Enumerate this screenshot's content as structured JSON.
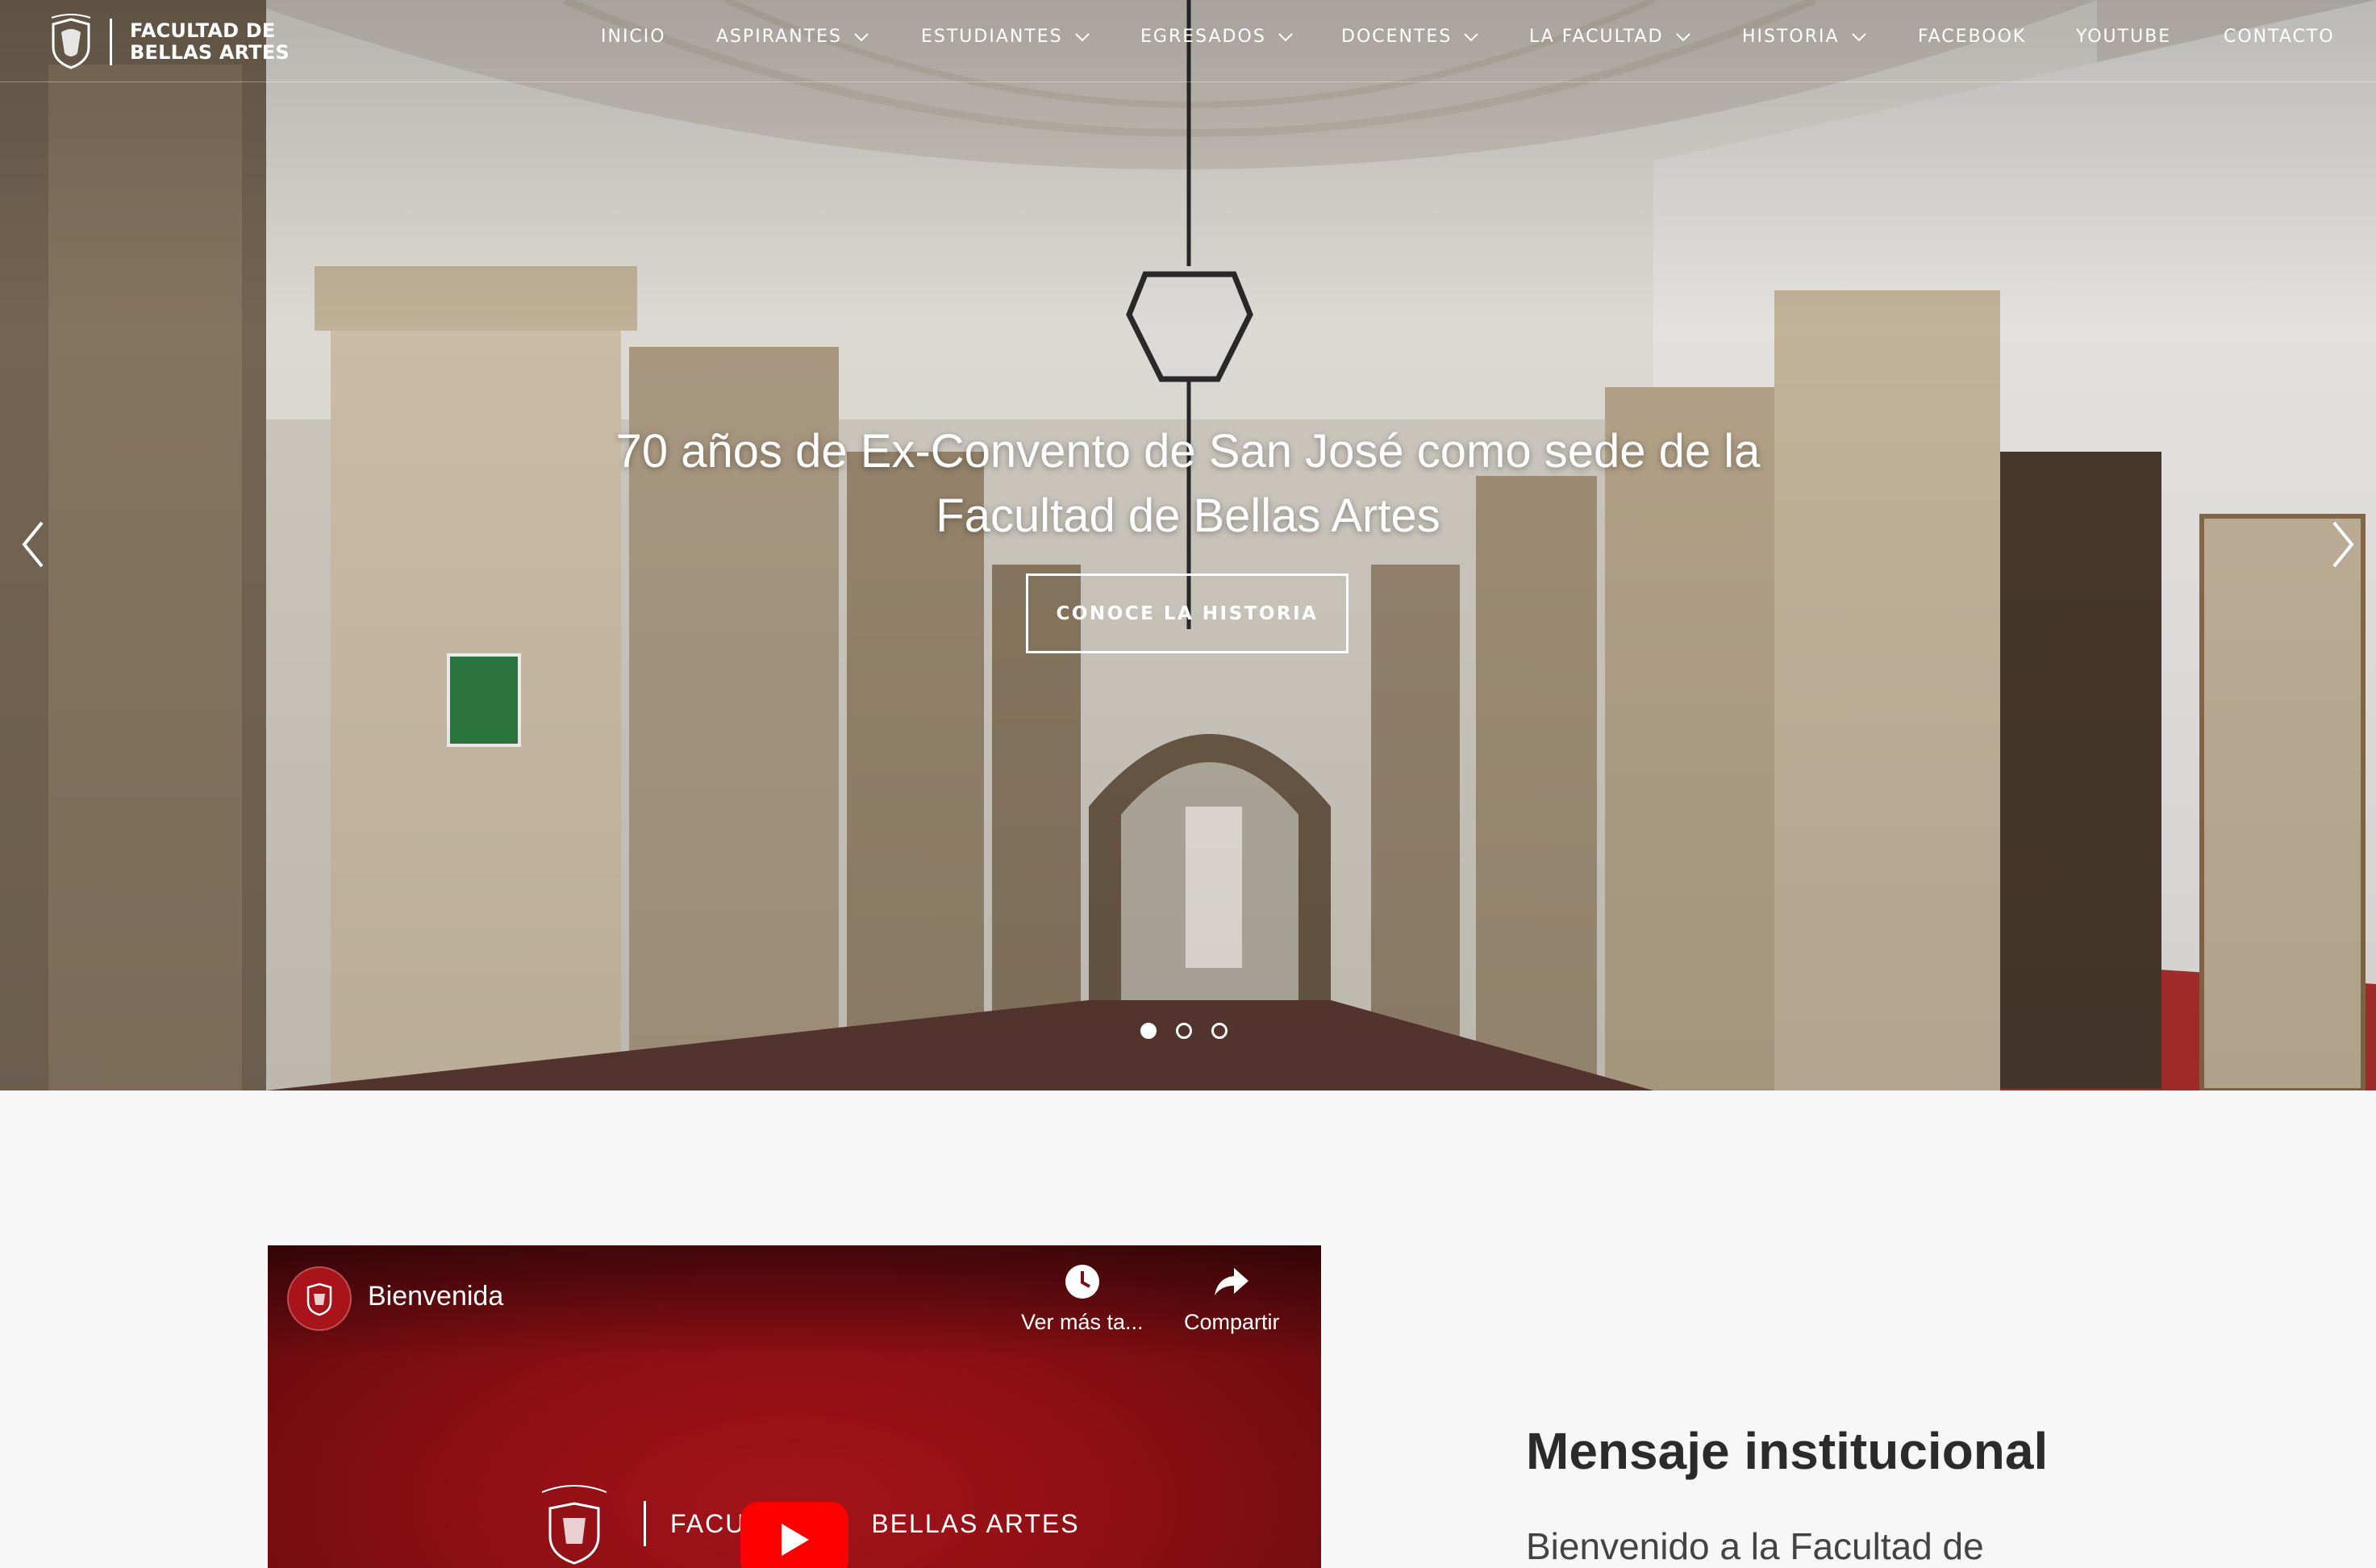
{
  "brand": {
    "line1": "FACULTAD DE",
    "line2": "BELLAS ARTES"
  },
  "nav": [
    {
      "label": "INICIO",
      "dropdown": false
    },
    {
      "label": "ASPIRANTES",
      "dropdown": true
    },
    {
      "label": "ESTUDIANTES",
      "dropdown": true
    },
    {
      "label": "EGRESADOS",
      "dropdown": true
    },
    {
      "label": "DOCENTES",
      "dropdown": true
    },
    {
      "label": "LA FACULTAD",
      "dropdown": true
    },
    {
      "label": "HISTORIA",
      "dropdown": true
    },
    {
      "label": "FACEBOOK",
      "dropdown": false
    },
    {
      "label": "YOUTUBE",
      "dropdown": false
    },
    {
      "label": "CONTACTO",
      "dropdown": false
    }
  ],
  "hero": {
    "title_line1": "70 años de Ex-Convento de San José como sede de la",
    "title_line2": "Facultad de Bellas Artes",
    "cta": "CONOCE LA HISTORIA",
    "slides": 3,
    "active_slide": 1,
    "icons": {
      "prev": "chevron-left-icon",
      "next": "chevron-right-icon"
    }
  },
  "video": {
    "title": "Bienvenida",
    "watch_later": "Ver más ta...",
    "share": "Compartir",
    "brand_text": "FACULTAD DE BELLAS ARTES",
    "brand_visible_left": "FACU",
    "brand_visible_right": "BELLAS ARTES",
    "colors": {
      "background": "#8c0f14",
      "play": "#ff0000"
    }
  },
  "message": {
    "title": "Mensaje institucional",
    "body": "Bienvenido a la Facultad de"
  }
}
